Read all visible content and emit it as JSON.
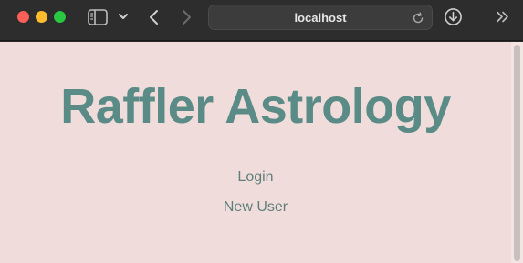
{
  "browser": {
    "address": "localhost",
    "icons": {
      "close": "close-window-icon",
      "minimize": "minimize-window-icon",
      "zoom": "zoom-window-icon",
      "sidebar": "sidebar-icon",
      "chevron": "chevron-down-icon",
      "back": "chevron-left-icon",
      "forward": "chevron-right-icon",
      "reload": "reload-icon",
      "downloads": "download-icon",
      "overflow": "double-chevron-right-icon"
    },
    "colors": {
      "close": "#fe5f57",
      "minimize": "#febc2e",
      "zoom": "#28c840",
      "toolbar": "#2d2d2d"
    }
  },
  "page": {
    "title": "Raffler Astrology",
    "links": {
      "login": "Login",
      "new_user": "New User"
    },
    "colors": {
      "background": "#f0dddb",
      "title": "#5a8b87",
      "link": "#5f7f7c"
    }
  }
}
